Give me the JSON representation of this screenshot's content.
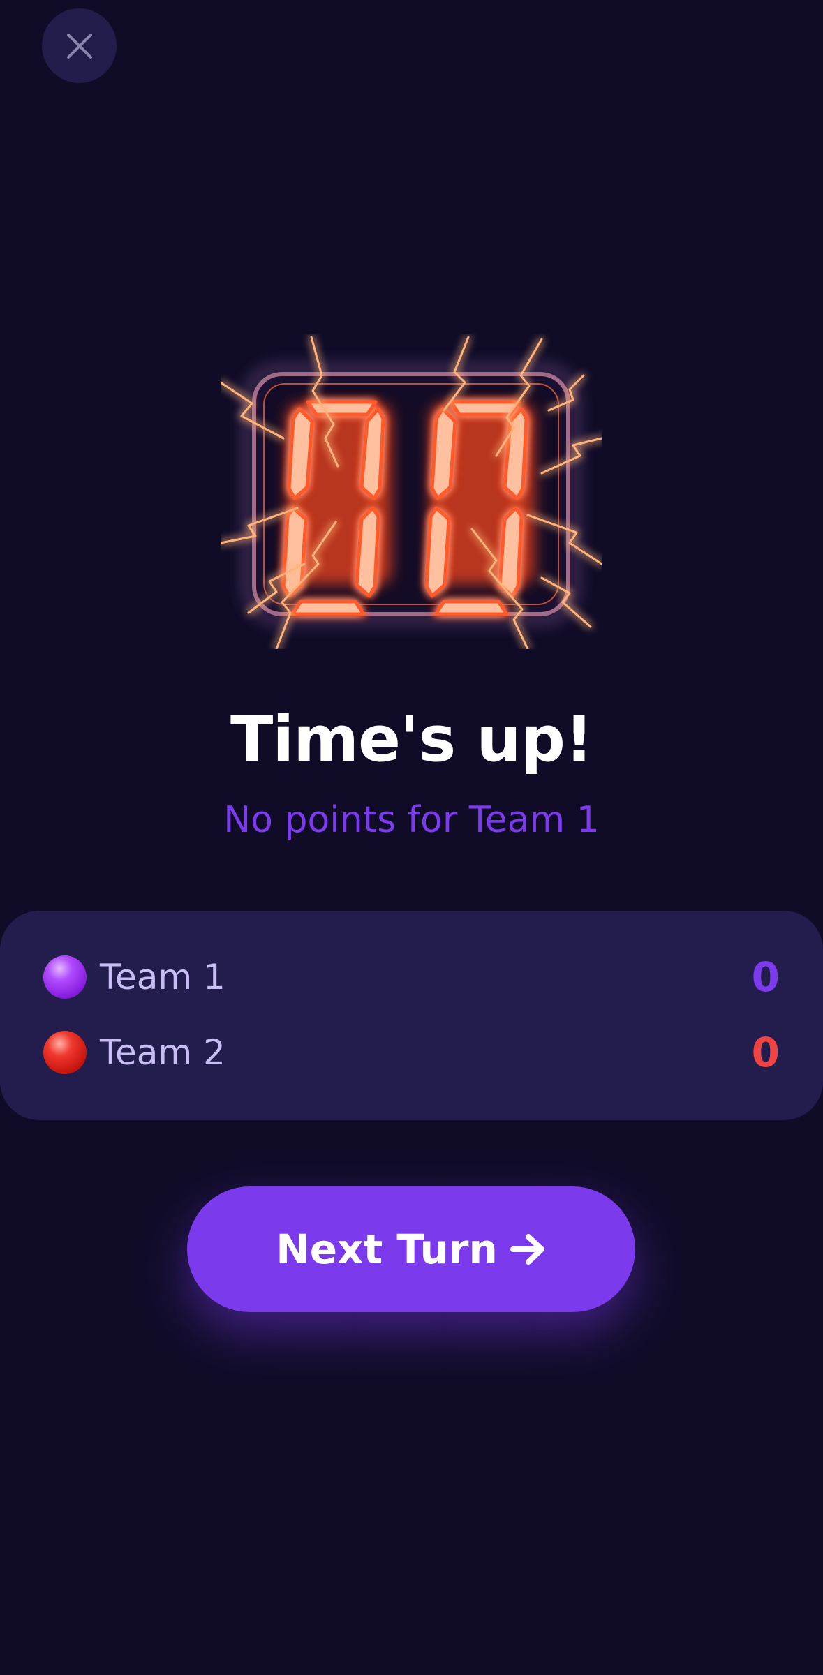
{
  "title": "Time's up!",
  "subtitle": "No points for Team 1",
  "timer_display": "00",
  "teams": [
    {
      "name": "Team 1",
      "score": "0",
      "color": "#7c3aed",
      "dot_icon": "purple-circle-icon"
    },
    {
      "name": "Team 2",
      "score": "0",
      "color": "#ef4444",
      "dot_icon": "red-circle-icon"
    }
  ],
  "next_button": {
    "label": "Next Turn",
    "icon": "arrow-right-icon"
  },
  "close_icon": "close-icon",
  "colors": {
    "background": "#100c28",
    "card": "#221d4c",
    "accent": "#7c3aed",
    "timer_glow": "#ff5a2c"
  }
}
